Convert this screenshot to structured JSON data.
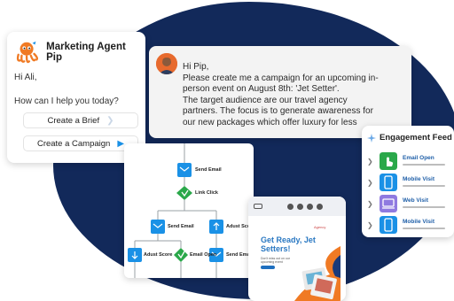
{
  "agent": {
    "name": "Marketing Agent Pip",
    "greeting": "Hi Ali,",
    "prompt": "How can I help you today?",
    "buttons": [
      "Create a Brief",
      "Create a Campaign"
    ]
  },
  "chat": {
    "lines": [
      "Hi Pip,",
      "Please create me a campaign for an upcoming in-",
      "person event on August 8th: 'Jet Setter'.",
      "The target audience are our travel agency",
      "partners. The focus is to generate awareness for",
      "our new packages which offer luxury for less"
    ]
  },
  "workflow": {
    "nodes": [
      "Send Email",
      "Link Click",
      "Send Email",
      "Adust Sco",
      "Adust Score",
      "Email Open",
      "Send Ema"
    ]
  },
  "preview": {
    "title_line1": "Get Ready, Jet",
    "title_line2": "Setters!",
    "logo": "Agency",
    "small_text": "Don't miss out on our upcoming event"
  },
  "feed": {
    "title": "Engagement Feed",
    "items": [
      "Email Open",
      "Mobile Visit",
      "Web Visit",
      "Mobile Visit"
    ]
  },
  "colors": {
    "navy": "#12295a",
    "orange": "#f07a24",
    "blue": "#1a91e6",
    "green": "#2aa84a"
  }
}
